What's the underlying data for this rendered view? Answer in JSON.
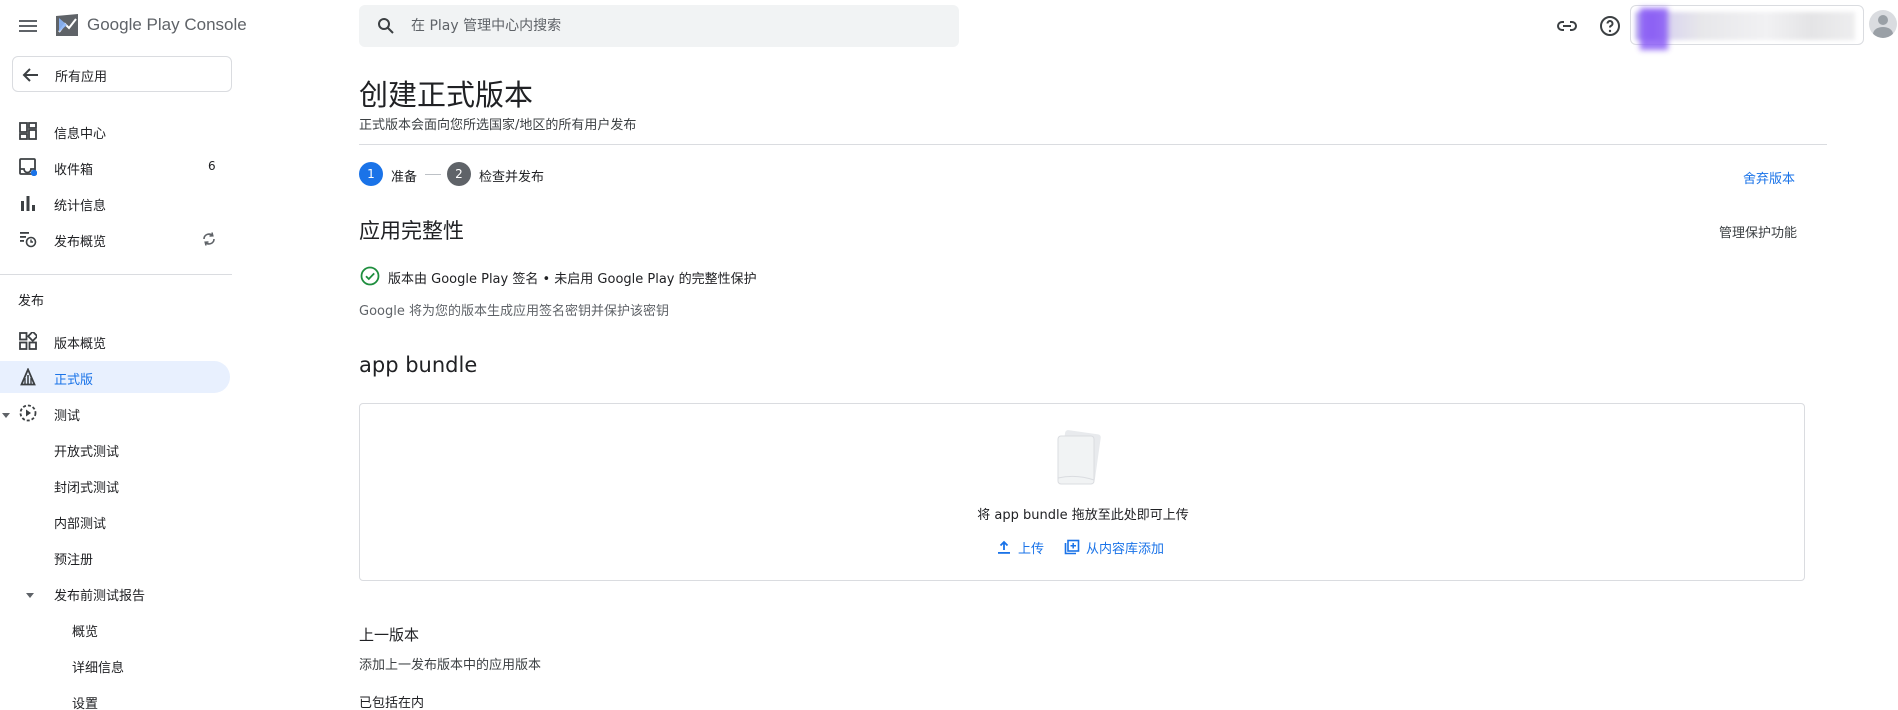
{
  "topbar": {
    "brand_google_play": "Google Play",
    "brand_console": " Console",
    "search_placeholder": "在 Play 管理中心内搜索"
  },
  "sidebar": {
    "all_apps_label": "所有应用",
    "items_top": [
      {
        "label": "信息中心",
        "icon": "dashboard-icon"
      },
      {
        "label": "收件箱",
        "icon": "inbox-icon",
        "count": "6"
      },
      {
        "label": "统计信息",
        "icon": "bar-chart-icon"
      },
      {
        "label": "发布概览",
        "icon": "publishing-overview-icon"
      }
    ],
    "section_release": "发布",
    "items_release": [
      {
        "label": "版本概览",
        "icon": "release-overview-icon"
      },
      {
        "label": "正式版",
        "icon": "production-icon",
        "active": true
      },
      {
        "label": "测试",
        "icon": "testing-icon"
      },
      {
        "label": "开放式测试"
      },
      {
        "label": "封闭式测试"
      },
      {
        "label": "内部测试"
      },
      {
        "label": "预注册"
      },
      {
        "label": "发布前测试报告"
      },
      {
        "label": "概览"
      },
      {
        "label": "详细信息"
      },
      {
        "label": "设置"
      }
    ]
  },
  "main": {
    "title": "创建正式版本",
    "subtitle": "正式版本会面向您所选国家/地区的所有用户发布",
    "steps": [
      {
        "number": "1",
        "label": "准备",
        "active": true
      },
      {
        "number": "2",
        "label": "检查并发布",
        "active": false
      }
    ],
    "discard_label": "舍弃版本",
    "integrity": {
      "heading": "应用完整性",
      "manage_label": "管理保护功能",
      "status_text": "版本由 Google Play 签名 • 未启用 Google Play 的完整性保护",
      "note": "Google 将为您的版本生成应用签名密钥并保护该密钥"
    },
    "bundle": {
      "heading": "app bundle",
      "drop_text": "将 app bundle 拖放至此处即可上传",
      "upload_label": "上传",
      "library_label": "从内容库添加"
    },
    "previous": {
      "heading": "上一版本",
      "description": "添加上一发布版本中的应用版本",
      "included_label": "已包括在内"
    }
  },
  "colors": {
    "accent": "#1a73e8",
    "active_bg": "#e8f0fe",
    "success": "#1e8e3e",
    "step_inactive": "#5f6368"
  }
}
